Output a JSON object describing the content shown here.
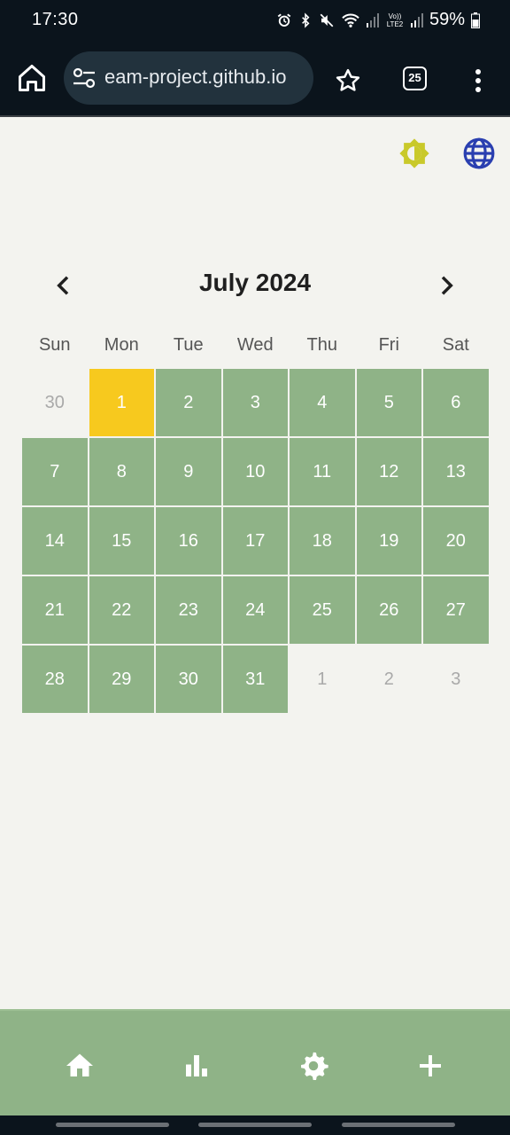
{
  "status_bar": {
    "time": "17:30",
    "network_label": "Vo)) LTE2",
    "battery": "59%"
  },
  "browser": {
    "url": "eam-project.github.io",
    "tab_count": "25"
  },
  "calendar": {
    "month_title": "July 2024",
    "weekdays": [
      "Sun",
      "Mon",
      "Tue",
      "Wed",
      "Thu",
      "Fri",
      "Sat"
    ],
    "days": [
      {
        "label": "30",
        "state": "out"
      },
      {
        "label": "1",
        "state": "today"
      },
      {
        "label": "2",
        "state": "in"
      },
      {
        "label": "3",
        "state": "in"
      },
      {
        "label": "4",
        "state": "in"
      },
      {
        "label": "5",
        "state": "in"
      },
      {
        "label": "6",
        "state": "in"
      },
      {
        "label": "7",
        "state": "in"
      },
      {
        "label": "8",
        "state": "in"
      },
      {
        "label": "9",
        "state": "in"
      },
      {
        "label": "10",
        "state": "in"
      },
      {
        "label": "11",
        "state": "in"
      },
      {
        "label": "12",
        "state": "in"
      },
      {
        "label": "13",
        "state": "in"
      },
      {
        "label": "14",
        "state": "in"
      },
      {
        "label": "15",
        "state": "in"
      },
      {
        "label": "16",
        "state": "in"
      },
      {
        "label": "17",
        "state": "in"
      },
      {
        "label": "18",
        "state": "in"
      },
      {
        "label": "19",
        "state": "in"
      },
      {
        "label": "20",
        "state": "in"
      },
      {
        "label": "21",
        "state": "in"
      },
      {
        "label": "22",
        "state": "in"
      },
      {
        "label": "23",
        "state": "in"
      },
      {
        "label": "24",
        "state": "in"
      },
      {
        "label": "25",
        "state": "in"
      },
      {
        "label": "26",
        "state": "in"
      },
      {
        "label": "27",
        "state": "in"
      },
      {
        "label": "28",
        "state": "in"
      },
      {
        "label": "29",
        "state": "in"
      },
      {
        "label": "30",
        "state": "in"
      },
      {
        "label": "31",
        "state": "in"
      },
      {
        "label": "1",
        "state": "out"
      },
      {
        "label": "2",
        "state": "out"
      },
      {
        "label": "3",
        "state": "out"
      }
    ]
  },
  "colors": {
    "day_in_month": "#8fb387",
    "today": "#f7c91e",
    "theme_icon": "#c9c92a",
    "language_icon": "#2a3fb0"
  },
  "icons": {
    "toolbar": [
      "brightness-icon",
      "globe-icon"
    ],
    "bottom_nav": [
      "home-icon",
      "bar-chart-icon",
      "settings-icon",
      "add-icon"
    ]
  }
}
